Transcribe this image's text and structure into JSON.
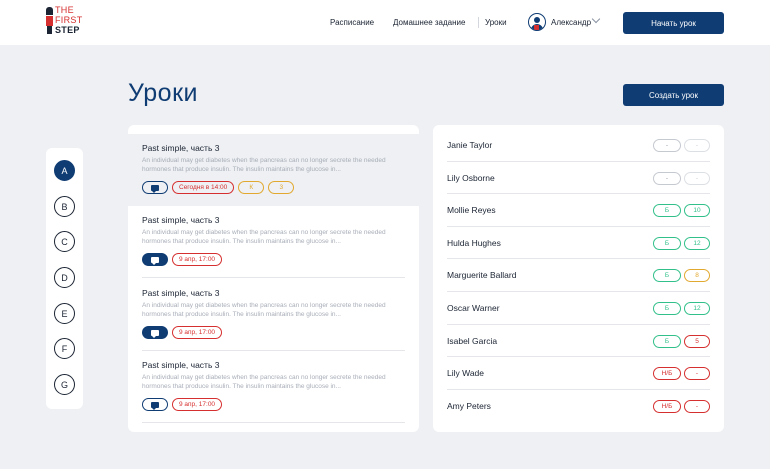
{
  "brand": {
    "line1": "THE",
    "line2": "FIRST",
    "line3": "STEP"
  },
  "nav": {
    "schedule": "Расписание",
    "homework": "Домашнее задание",
    "lessons": "Уроки",
    "user_name": "Александр",
    "start_lesson": "Начать урок"
  },
  "page": {
    "title": "Уроки",
    "create_lesson": "Создать урок"
  },
  "letters": [
    {
      "label": "A",
      "active": true
    },
    {
      "label": "B",
      "active": false
    },
    {
      "label": "C",
      "active": false
    },
    {
      "label": "D",
      "active": false
    },
    {
      "label": "E",
      "active": false
    },
    {
      "label": "F",
      "active": false
    },
    {
      "label": "G",
      "active": false
    }
  ],
  "lessons": [
    {
      "title": "Past simple, часть 3",
      "description": "An individual may get diabetes when the pancreas can no longer secrete the needed hormones that produce insulin. The insulin maintains the glucose in...",
      "chat_filled": false,
      "date": "Сегодня в 14:00",
      "tag2": "К",
      "tag3": "3"
    },
    {
      "title": "Past simple, часть 3",
      "description": "An individual may get diabetes when the pancreas can no longer secrete the needed hormones that produce insulin. The insulin maintains the glucose in...",
      "chat_filled": true,
      "date": "9 апр, 17:00"
    },
    {
      "title": "Past simple, часть 3",
      "description": "An individual may get diabetes when the pancreas can no longer secrete the needed hormones that produce insulin. The insulin maintains the glucose in...",
      "chat_filled": true,
      "date": "9 апр, 17:00"
    },
    {
      "title": "Past simple, часть 3",
      "description": "An individual may get diabetes when the pancreas can no longer secrete the needed hormones that produce insulin. The insulin maintains the glucose in...",
      "chat_filled": false,
      "date": "9 апр, 17:00"
    }
  ],
  "students": [
    {
      "name": "Janie Taylor",
      "attendance": "-",
      "grade": "-",
      "status": "none"
    },
    {
      "name": "Lily Osborne",
      "attendance": "-",
      "grade": "-",
      "status": "none"
    },
    {
      "name": "Mollie Reyes",
      "attendance": "Б",
      "grade": "10",
      "status": "good"
    },
    {
      "name": "Hulda Hughes",
      "attendance": "Б",
      "grade": "12",
      "status": "good"
    },
    {
      "name": "Marguerite Ballard",
      "attendance": "Б",
      "grade": "8",
      "status": "mid"
    },
    {
      "name": "Oscar Warner",
      "attendance": "Б",
      "grade": "12",
      "status": "good"
    },
    {
      "name": "Isabel Garcia",
      "attendance": "Б",
      "grade": "5",
      "status": "low"
    },
    {
      "name": "Lily Wade",
      "attendance": "Н/Б",
      "grade": "-",
      "status": "absent"
    },
    {
      "name": "Amy Peters",
      "attendance": "Н/Б",
      "grade": "-",
      "status": "absent"
    }
  ],
  "colors": {
    "primary": "#0f3c73",
    "accent_red": "#d62f2f",
    "green": "#32c08a",
    "yellow": "#e2a930",
    "background": "#eef0f3"
  }
}
